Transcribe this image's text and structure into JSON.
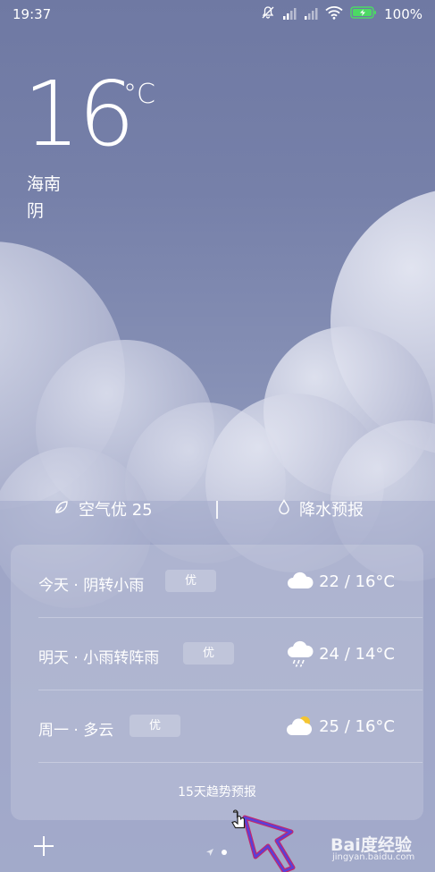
{
  "status_bar": {
    "time": "19:37",
    "battery_percent": "100%",
    "icons": [
      "mute-icon",
      "signal-icon",
      "signal-icon",
      "wifi-icon",
      "battery-charging-icon"
    ]
  },
  "current": {
    "temperature": "16",
    "unit": "°C",
    "city": "海南",
    "condition": "阴"
  },
  "info_row": {
    "air_quality": "空气优 25",
    "precipitation": "降水预报"
  },
  "forecast": {
    "days": [
      {
        "label": "今天 · 阴转小雨",
        "aqi_badge": "优",
        "icon": "cloudy-icon",
        "temps": "22 / 16°C"
      },
      {
        "label": "明天 · 小雨转阵雨",
        "aqi_badge": "优",
        "icon": "rain-cloud-icon",
        "temps": "24 / 14°C"
      },
      {
        "label": "周一 · 多云",
        "aqi_badge": "优",
        "icon": "partly-cloudy-icon",
        "temps": "25 / 16°C"
      }
    ],
    "trend_link": "15天趋势预报"
  },
  "watermark": {
    "brand": "Bai度经验",
    "url": "jingyan.baidu.com"
  },
  "colors": {
    "sky_top": "#6f79a3",
    "sky_bottom": "#a3aacb",
    "cloud": "#d3d6e8",
    "sun": "#f4c531",
    "battery": "#4cd964"
  }
}
